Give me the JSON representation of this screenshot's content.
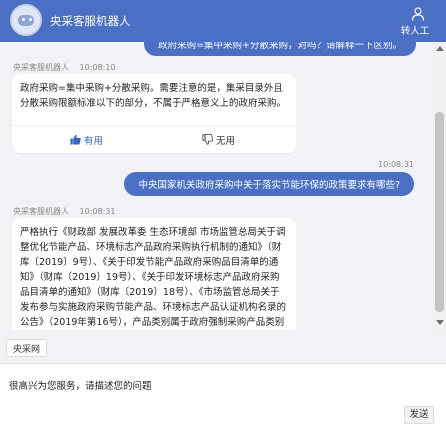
{
  "header": {
    "title": "央采客服机器人",
    "transfer_label": "转人工",
    "color": "#4a6fc4"
  },
  "messages": [
    {
      "role": "user",
      "text": "政府采购=集中采购+分散采购，对吗？请解释一下区别。",
      "partial": true
    },
    {
      "role": "bot",
      "name": "央采客服机器人",
      "time": "10:08:10",
      "text": "政府采购=集中采购+分散采购。需要注意的是，集采目录外且分散采购限额标准以下的部分，不属于严格意义上的政府采购。",
      "feedback": {
        "useful": "有用",
        "useless": "无用"
      }
    },
    {
      "role": "user",
      "time": "10:08:31",
      "text": "中央国家机关政府采购中关于落实节能环保的政策要求有哪些?"
    },
    {
      "role": "bot",
      "name": "央采客服机器人",
      "time": "10:08:31",
      "text": "严格执行《财政部 发展改革委 生态环境部 市场监管总局关于调整优化节能产品、环境标志产品政府采购执行机制的通知》（财库〔2019〕9号）、《关于印发节能产品政府采购品目清单的通知》（财库〔2019〕19号）、《关于印发环境标志产品政府采购品目清单的通知》（财库〔2019〕18号）、《市场监管总局关于发布参与实施政府采购节能产品、环境标志产品认证机构名录的公告》（2019年第16号），产品类别属于政府强制采购产品类别的，须按照要求提供依据国家确定的认证机构"
    }
  ],
  "quick_reply": "央采网",
  "input": {
    "text": "很高兴为您服务，请描述您的问题"
  },
  "send_label": "发送"
}
